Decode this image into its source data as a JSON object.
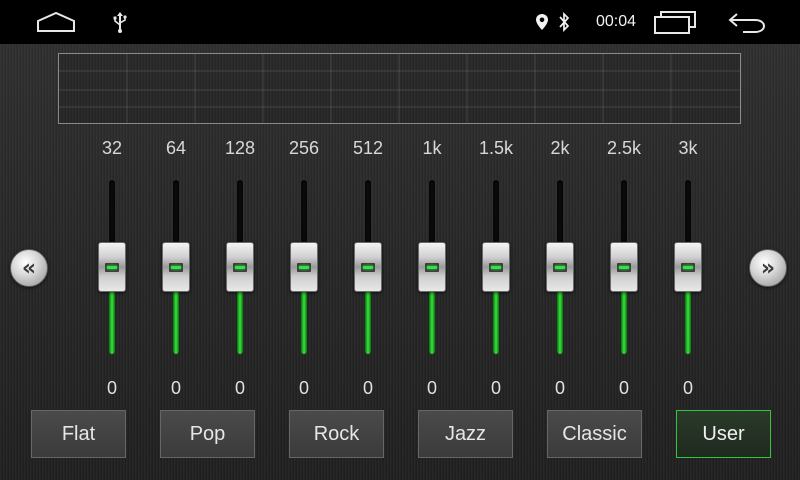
{
  "status_bar": {
    "time": "00:04",
    "icons": [
      "home-icon",
      "usb-icon",
      "location-icon",
      "bluetooth-icon",
      "recents-icon",
      "back-icon"
    ]
  },
  "equalizer": {
    "bands": [
      {
        "freq": "32",
        "gain": "0"
      },
      {
        "freq": "64",
        "gain": "0"
      },
      {
        "freq": "128",
        "gain": "0"
      },
      {
        "freq": "256",
        "gain": "0"
      },
      {
        "freq": "512",
        "gain": "0"
      },
      {
        "freq": "1k",
        "gain": "0"
      },
      {
        "freq": "1.5k",
        "gain": "0"
      },
      {
        "freq": "2k",
        "gain": "0"
      },
      {
        "freq": "2.5k",
        "gain": "0"
      },
      {
        "freq": "3k",
        "gain": "0"
      }
    ],
    "slider_level": 0.5,
    "prev_page_glyph": "«",
    "next_page_glyph": "»"
  },
  "presets": {
    "items": [
      "Flat",
      "Pop",
      "Rock",
      "Jazz",
      "Classic",
      "User"
    ],
    "selected": "User"
  },
  "colors": {
    "accent_green": "#33e046",
    "curve_start": "#e0305a",
    "curve_end": "#f0e030"
  }
}
